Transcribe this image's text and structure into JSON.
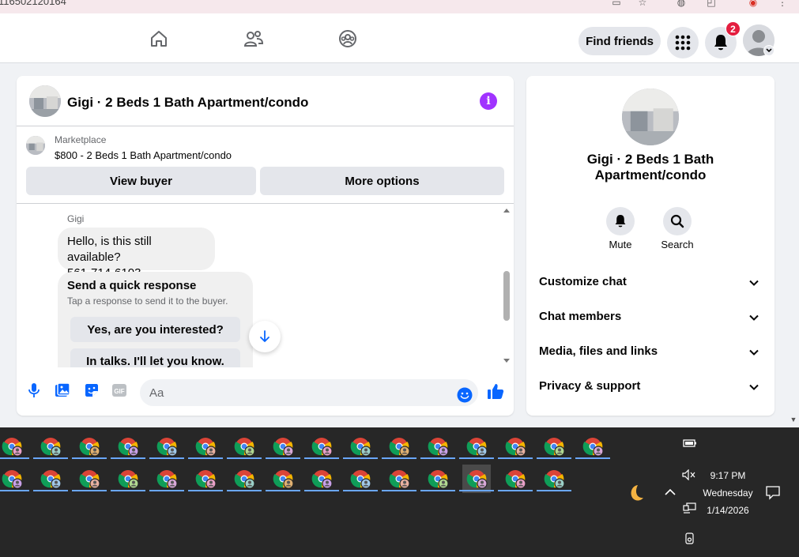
{
  "browser": {
    "url_fragment": "116502120164"
  },
  "nav": {
    "find_friends": "Find friends",
    "notification_count": "2"
  },
  "chat": {
    "title": "Gigi · 2 Beds 1 Bath Apartment/condo",
    "marketplace_label": "Marketplace",
    "listing": "$800 - 2 Beds 1 Bath Apartment/condo",
    "view_buyer": "View buyer",
    "more_options": "More options",
    "sender": "Gigi",
    "message_line1": "Hello, is this still available?",
    "message_line2": "561-714-6103",
    "quick_title": "Send a quick response",
    "quick_sub": "Tap a response to send it to the buyer.",
    "quick_options": [
      "Yes, are you interested?",
      "In talks. I'll let you know."
    ],
    "composer_placeholder": "Aa",
    "gif_label": "GIF"
  },
  "panel": {
    "name_line1": "Gigi · 2 Beds 1 Bath",
    "name_line2": "Apartment/condo",
    "mute": "Mute",
    "search": "Search",
    "sections": [
      "Customize chat",
      "Chat members",
      "Media, files and links",
      "Privacy & support"
    ]
  },
  "taskbar": {
    "time": "9:17 PM",
    "day": "Wednesday",
    "date": "1/14/2026"
  },
  "colors": {
    "fb_blue": "#0866ff",
    "info_purple": "#a033ff",
    "badge_red": "#e41e3f"
  }
}
